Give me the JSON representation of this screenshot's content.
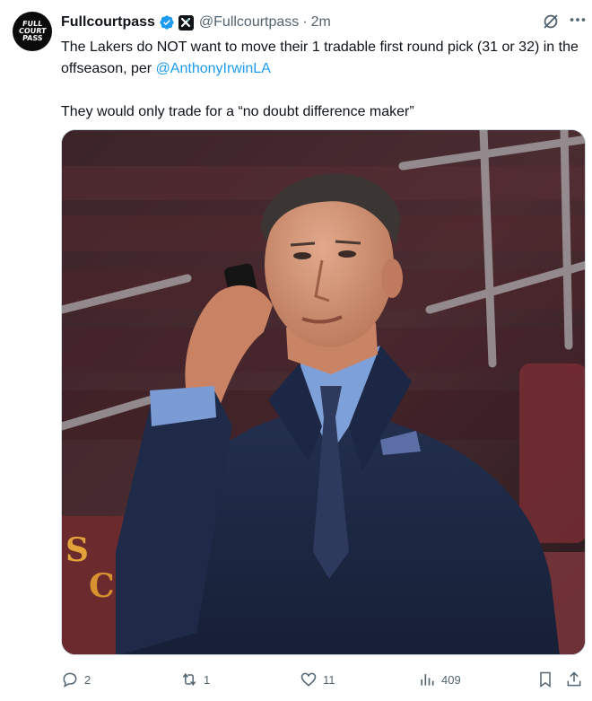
{
  "author": {
    "avatar_lines": [
      "FULL",
      "COURT",
      "PASS"
    ],
    "display_name": "Fullcourtpass",
    "handle": "@Fullcourtpass",
    "separator": "·",
    "time": "2m",
    "verified_color": "#1d9bf0"
  },
  "tweet": {
    "line1": "The Lakers do NOT want to move their 1 tradable first round pick (31 or 32) in the offseason, per ",
    "mention": "@AnthonyIrwinLA",
    "line2": "They would only trade for a “no doubt difference maker”"
  },
  "media": {
    "subject": "photo-man-in-suit-on-phone"
  },
  "actions": {
    "replies": "2",
    "reposts": "1",
    "likes": "11",
    "views": "409"
  },
  "colors": {
    "link": "#1d9bf0",
    "muted": "#536471",
    "text": "#0f1419"
  }
}
